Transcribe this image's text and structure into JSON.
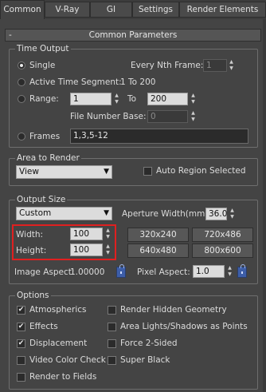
{
  "tabs": [
    "Common",
    "V-Ray",
    "GI",
    "Settings",
    "Render Elements"
  ],
  "rollout": {
    "title": "Common Parameters",
    "toggle": "-"
  },
  "time_output": {
    "label": "Time Output",
    "single": "Single",
    "every_nth": "Every Nth Frame:",
    "every_nth_value": "1",
    "active_segment": "Active Time Segment:",
    "active_segment_value": "1 To 200",
    "range": "Range:",
    "range_from": "1",
    "to": "To",
    "range_to": "200",
    "file_number_base": "File Number Base:",
    "file_number_base_value": "0",
    "frames": "Frames",
    "frames_value": "1,3,5-12",
    "selected": "single"
  },
  "area_to_render": {
    "label": "Area to Render",
    "selected": "View",
    "auto_region": "Auto Region Selected"
  },
  "output_size": {
    "label": "Output Size",
    "preset": "Custom",
    "aperture_label": "Aperture Width(mm):",
    "aperture_value": "36.0",
    "width_label": "Width:",
    "width_value": "100",
    "height_label": "Height:",
    "height_value": "100",
    "presets": [
      "320x240",
      "720x486",
      "640x480",
      "800x600"
    ],
    "image_aspect_label": "Image Aspect:",
    "image_aspect_value": "1.00000",
    "pixel_aspect_label": "Pixel Aspect:",
    "pixel_aspect_value": "1.0"
  },
  "options": {
    "label": "Options",
    "items": [
      {
        "label": "Atmospherics",
        "checked": true
      },
      {
        "label": "Render Hidden Geometry",
        "checked": false
      },
      {
        "label": "Effects",
        "checked": true
      },
      {
        "label": "Area Lights/Shadows as Points",
        "checked": false
      },
      {
        "label": "Displacement",
        "checked": true
      },
      {
        "label": "Force 2-Sided",
        "checked": false
      },
      {
        "label": "Video Color Check",
        "checked": false
      },
      {
        "label": "Super Black",
        "checked": false
      },
      {
        "label": "Render to Fields",
        "checked": false
      }
    ]
  },
  "glyphs": {
    "check": "✔",
    "dropdown": "▼",
    "spin_up": "▲",
    "spin_down": "▼"
  },
  "colors": {
    "highlight": "#e02020",
    "lock": "#3d5ea8"
  }
}
